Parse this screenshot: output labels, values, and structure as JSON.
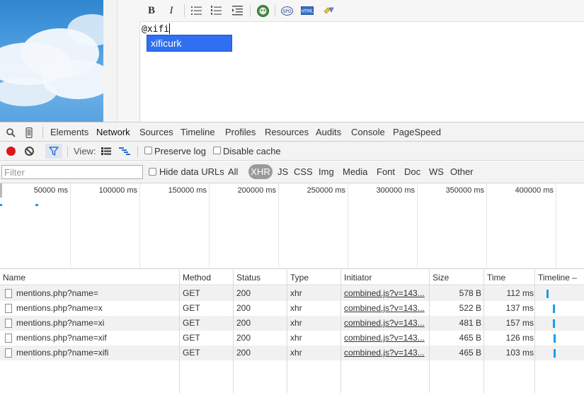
{
  "editor": {
    "typed_text": "@xifi",
    "suggestion": "xificurk",
    "toolbar": {
      "bold_label": "B",
      "italic_label": "I"
    }
  },
  "devtools": {
    "tabs": [
      "Elements",
      "Network",
      "Sources",
      "Timeline",
      "Profiles",
      "Resources",
      "Audits",
      "Console",
      "PageSpeed"
    ],
    "active_tab": "Network",
    "network_bar": {
      "view_label": "View:",
      "preserve_log_label": "Preserve log",
      "disable_cache_label": "Disable cache"
    },
    "filter_row": {
      "placeholder": "Filter",
      "hide_data_urls_label": "Hide data URLs",
      "types": [
        "All",
        "XHR",
        "JS",
        "CSS",
        "Img",
        "Media",
        "Font",
        "Doc",
        "WS",
        "Other"
      ],
      "active_type": "XHR"
    },
    "overview": {
      "tick_labels": [
        "50000 ms",
        "100000 ms",
        "150000 ms",
        "200000 ms",
        "250000 ms",
        "300000 ms",
        "350000 ms",
        "400000 ms"
      ]
    },
    "table": {
      "headers": [
        "Name",
        "Method",
        "Status",
        "Type",
        "Initiator",
        "Size",
        "Time",
        "Timeline – S"
      ],
      "rows": [
        {
          "name": "mentions.php?name=",
          "method": "GET",
          "status": "200",
          "type": "xhr",
          "initiator": "combined.js?v=143...",
          "size": "578 B",
          "time": "112 ms"
        },
        {
          "name": "mentions.php?name=x",
          "method": "GET",
          "status": "200",
          "type": "xhr",
          "initiator": "combined.js?v=143...",
          "size": "522 B",
          "time": "137 ms"
        },
        {
          "name": "mentions.php?name=xi",
          "method": "GET",
          "status": "200",
          "type": "xhr",
          "initiator": "combined.js?v=143...",
          "size": "481 B",
          "time": "157 ms"
        },
        {
          "name": "mentions.php?name=xif",
          "method": "GET",
          "status": "200",
          "type": "xhr",
          "initiator": "combined.js?v=143...",
          "size": "465 B",
          "time": "126 ms"
        },
        {
          "name": "mentions.php?name=xifi",
          "method": "GET",
          "status": "200",
          "type": "xhr",
          "initiator": "combined.js?v=143...",
          "size": "465 B",
          "time": "103 ms"
        }
      ]
    },
    "colors": {
      "accent_blue": "#1a9ee5",
      "record_red": "#e0151b",
      "suggest_blue": "#2f6ff1"
    }
  }
}
